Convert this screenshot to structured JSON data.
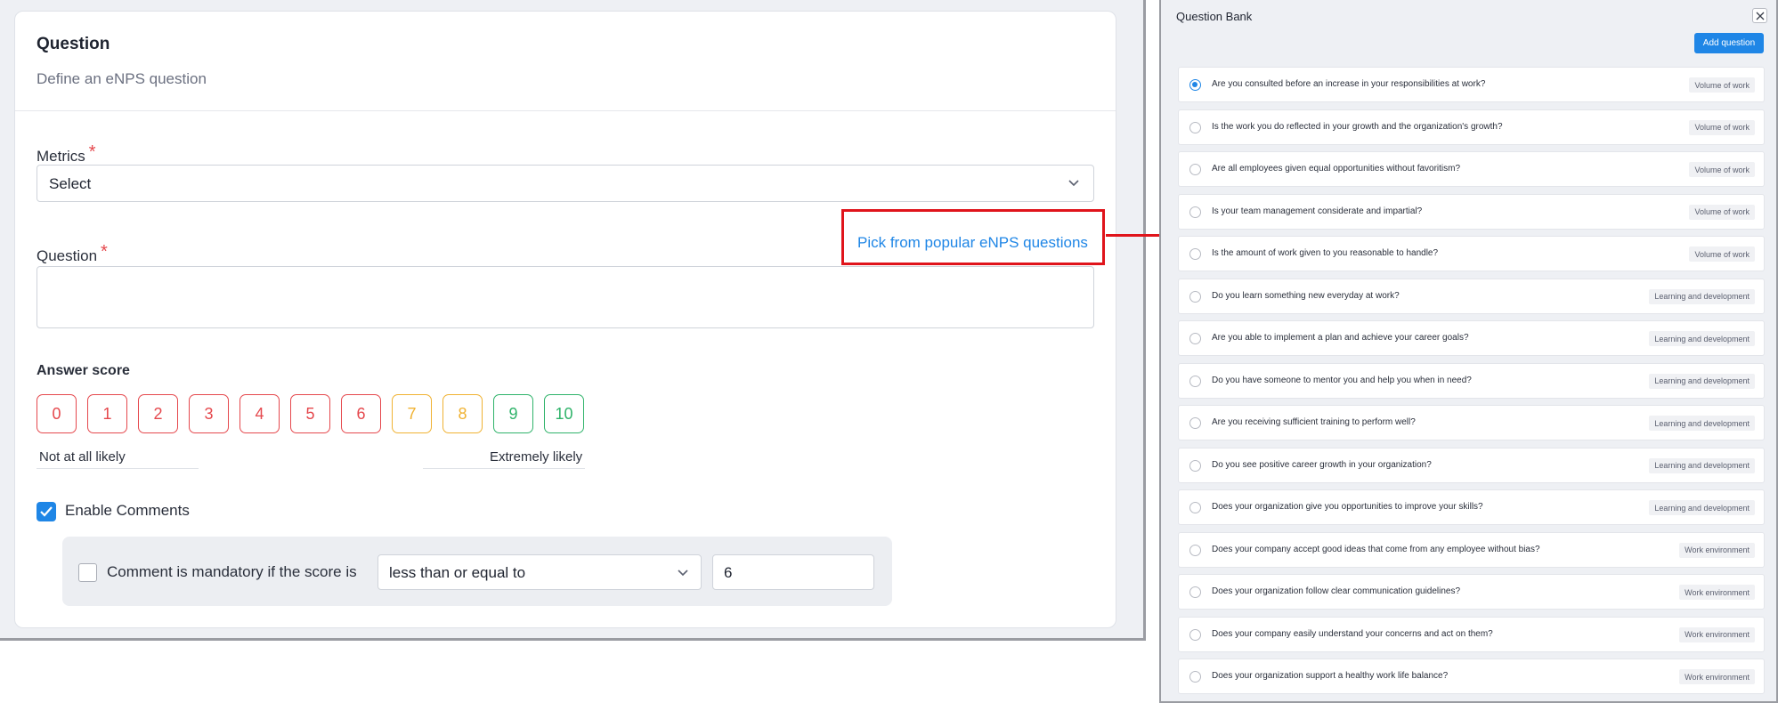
{
  "question_form": {
    "title": "Question",
    "subtitle": "Define an eNPS question",
    "metrics_label": "Metrics",
    "required_mark": "*",
    "metrics_value": "Select",
    "question_label": "Question",
    "pick_link": "Pick from popular eNPS questions",
    "question_value": "",
    "answer_score_label": "Answer score",
    "scores": [
      {
        "label": "0",
        "color": "#e5484d"
      },
      {
        "label": "1",
        "color": "#e5484d"
      },
      {
        "label": "2",
        "color": "#e5484d"
      },
      {
        "label": "3",
        "color": "#e5484d"
      },
      {
        "label": "4",
        "color": "#e5484d"
      },
      {
        "label": "5",
        "color": "#e5484d"
      },
      {
        "label": "6",
        "color": "#e5484d"
      },
      {
        "label": "7",
        "color": "#f0b232"
      },
      {
        "label": "8",
        "color": "#f0b232"
      },
      {
        "label": "9",
        "color": "#2fb36a"
      },
      {
        "label": "10",
        "color": "#2fb36a"
      }
    ],
    "low_label": "Not at all likely",
    "high_label": "Extremely likely",
    "enable_comments_label": "Enable Comments",
    "enable_comments_checked": true,
    "comment_mandatory_label": "Comment is mandatory if the score is",
    "comment_mandatory_checked": false,
    "condition_value": "less than or equal to",
    "threshold_value": "6",
    "accent_color": "#1f86e6",
    "highlight_color": "#e0141b"
  },
  "question_bank": {
    "title": "Question Bank",
    "add_button": "Add question",
    "items": [
      {
        "text": "Are you consulted before an increase in your responsibilities at work?",
        "tag": "Volume of work",
        "selected": true
      },
      {
        "text": "Is the work you do reflected in your growth and the organization's growth?",
        "tag": "Volume of work",
        "selected": false
      },
      {
        "text": "Are all employees given equal opportunities without favoritism?",
        "tag": "Volume of work",
        "selected": false
      },
      {
        "text": "Is your team management considerate and impartial?",
        "tag": "Volume of work",
        "selected": false
      },
      {
        "text": "Is the amount of work given to you reasonable to handle?",
        "tag": "Volume of work",
        "selected": false
      },
      {
        "text": "Do you learn something new everyday at work?",
        "tag": "Learning and development",
        "selected": false
      },
      {
        "text": "Are you able to implement a plan and achieve your career goals?",
        "tag": "Learning and development",
        "selected": false
      },
      {
        "text": "Do you have someone to mentor you and help you when in need?",
        "tag": "Learning and development",
        "selected": false
      },
      {
        "text": "Are you receiving sufficient training to perform well?",
        "tag": "Learning and development",
        "selected": false
      },
      {
        "text": "Do you see positive career growth in your organization?",
        "tag": "Learning and development",
        "selected": false
      },
      {
        "text": "Does your organization give you opportunities to improve your skills?",
        "tag": "Learning and development",
        "selected": false
      },
      {
        "text": "Does your company accept good ideas that come from any employee without bias?",
        "tag": "Work environment",
        "selected": false
      },
      {
        "text": "Does your organization follow clear communication guidelines?",
        "tag": "Work environment",
        "selected": false
      },
      {
        "text": "Does your company easily understand your concerns and act on them?",
        "tag": "Work environment",
        "selected": false
      },
      {
        "text": "Does your organization support a healthy work life balance?",
        "tag": "Work environment",
        "selected": false
      }
    ]
  }
}
